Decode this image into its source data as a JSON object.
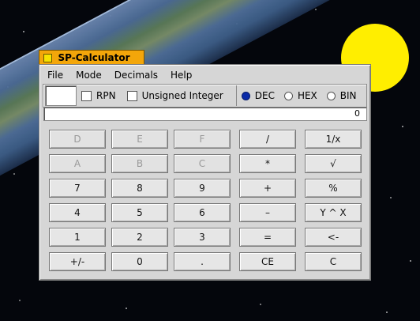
{
  "window": {
    "title": "SP-Calculator"
  },
  "menu": [
    {
      "label": "File"
    },
    {
      "label": "Mode"
    },
    {
      "label": "Decimals"
    },
    {
      "label": "Help"
    }
  ],
  "options": {
    "rpn_label": "RPN",
    "rpn_checked": false,
    "unsigned_label": "Unsigned Integer",
    "unsigned_checked": false,
    "bases": [
      {
        "label": "DEC",
        "selected": true
      },
      {
        "label": "HEX",
        "selected": false
      },
      {
        "label": "BIN",
        "selected": false
      }
    ]
  },
  "display": {
    "value": "0"
  },
  "keys": {
    "k_d": {
      "label": "D",
      "enabled": false
    },
    "k_e": {
      "label": "E",
      "enabled": false
    },
    "k_f": {
      "label": "F",
      "enabled": false
    },
    "k_div": {
      "label": "/",
      "enabled": true
    },
    "k_inv": {
      "label": "1/x",
      "enabled": true
    },
    "k_a": {
      "label": "A",
      "enabled": false
    },
    "k_b": {
      "label": "B",
      "enabled": false
    },
    "k_c": {
      "label": "C",
      "enabled": false
    },
    "k_mul": {
      "label": "*",
      "enabled": true
    },
    "k_sqrt": {
      "label": "√",
      "enabled": true
    },
    "k_7": {
      "label": "7",
      "enabled": true
    },
    "k_8": {
      "label": "8",
      "enabled": true
    },
    "k_9": {
      "label": "9",
      "enabled": true
    },
    "k_add": {
      "label": "+",
      "enabled": true
    },
    "k_pct": {
      "label": "%",
      "enabled": true
    },
    "k_4": {
      "label": "4",
      "enabled": true
    },
    "k_5": {
      "label": "5",
      "enabled": true
    },
    "k_6": {
      "label": "6",
      "enabled": true
    },
    "k_sub": {
      "label": "–",
      "enabled": true
    },
    "k_pow": {
      "label": "Y ^ X",
      "enabled": true
    },
    "k_1": {
      "label": "1",
      "enabled": true
    },
    "k_2": {
      "label": "2",
      "enabled": true
    },
    "k_3": {
      "label": "3",
      "enabled": true
    },
    "k_eq": {
      "label": "=",
      "enabled": true
    },
    "k_back": {
      "label": "<-",
      "enabled": true
    },
    "k_neg": {
      "label": "+/-",
      "enabled": true
    },
    "k_0": {
      "label": "0",
      "enabled": true
    },
    "k_dot": {
      "label": ".",
      "enabled": true
    },
    "k_ce": {
      "label": "CE",
      "enabled": true
    },
    "k_clear": {
      "label": "C",
      "enabled": true
    }
  },
  "colors": {
    "title_tab": "#f3a60a",
    "sun": "#ffee00",
    "radio_selected": "#0a2aa8"
  }
}
